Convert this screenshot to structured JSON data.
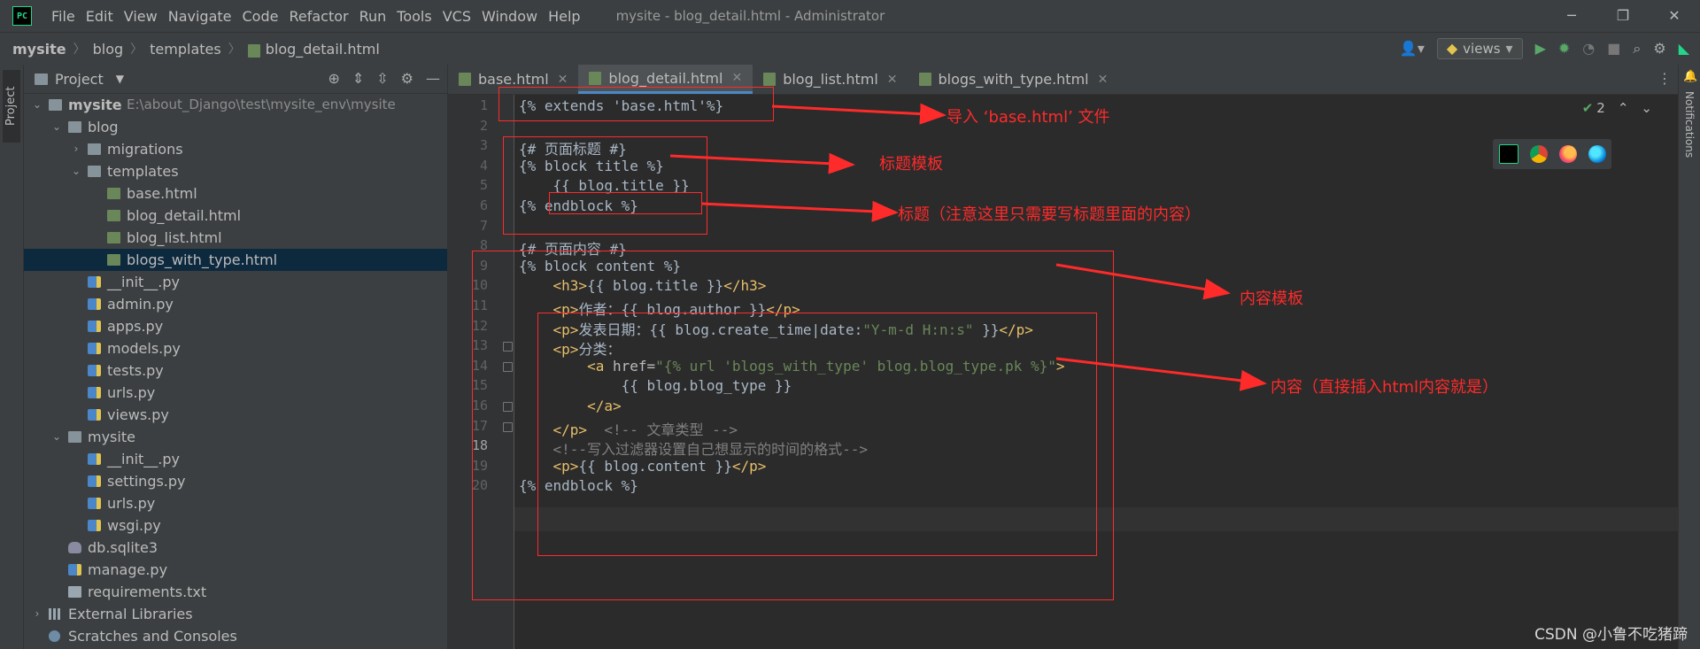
{
  "window": {
    "title": "mysite - blog_detail.html - Administrator",
    "menu": [
      "File",
      "Edit",
      "View",
      "Navigate",
      "Code",
      "Refactor",
      "Run",
      "Tools",
      "VCS",
      "Window",
      "Help"
    ],
    "controls": {
      "minimize": "─",
      "maximize": "❐",
      "close": "✕"
    }
  },
  "breadcrumb": [
    "mysite",
    "blog",
    "templates",
    "blog_detail.html"
  ],
  "toolbar": {
    "run_config": "views"
  },
  "project_panel": {
    "tab_label": "Project",
    "title": "Project",
    "tree": [
      {
        "label": "mysite",
        "path": "E:\\about_Django\\test\\mysite_env\\mysite",
        "depth": 0,
        "icon": "folder",
        "arrow": "open"
      },
      {
        "label": "blog",
        "depth": 1,
        "icon": "folder",
        "arrow": "open"
      },
      {
        "label": "migrations",
        "depth": 2,
        "icon": "folder",
        "arrow": "closed"
      },
      {
        "label": "templates",
        "depth": 2,
        "icon": "folder",
        "arrow": "open"
      },
      {
        "label": "base.html",
        "depth": 3,
        "icon": "html"
      },
      {
        "label": "blog_detail.html",
        "depth": 3,
        "icon": "html"
      },
      {
        "label": "blog_list.html",
        "depth": 3,
        "icon": "html"
      },
      {
        "label": "blogs_with_type.html",
        "depth": 3,
        "icon": "html",
        "selected": true
      },
      {
        "label": "__init__.py",
        "depth": 2,
        "icon": "py"
      },
      {
        "label": "admin.py",
        "depth": 2,
        "icon": "py"
      },
      {
        "label": "apps.py",
        "depth": 2,
        "icon": "py"
      },
      {
        "label": "models.py",
        "depth": 2,
        "icon": "py"
      },
      {
        "label": "tests.py",
        "depth": 2,
        "icon": "py"
      },
      {
        "label": "urls.py",
        "depth": 2,
        "icon": "py"
      },
      {
        "label": "views.py",
        "depth": 2,
        "icon": "py"
      },
      {
        "label": "mysite",
        "depth": 1,
        "icon": "folder",
        "arrow": "open"
      },
      {
        "label": "__init__.py",
        "depth": 2,
        "icon": "py"
      },
      {
        "label": "settings.py",
        "depth": 2,
        "icon": "py"
      },
      {
        "label": "urls.py",
        "depth": 2,
        "icon": "py"
      },
      {
        "label": "wsgi.py",
        "depth": 2,
        "icon": "py"
      },
      {
        "label": "db.sqlite3",
        "depth": 1,
        "icon": "db"
      },
      {
        "label": "manage.py",
        "depth": 1,
        "icon": "py"
      },
      {
        "label": "requirements.txt",
        "depth": 1,
        "icon": "txt"
      },
      {
        "label": "External Libraries",
        "depth": 0,
        "icon": "lib",
        "arrow": "closed"
      },
      {
        "label": "Scratches and Consoles",
        "depth": 0,
        "icon": "scratch"
      }
    ]
  },
  "tabs": [
    {
      "label": "base.html",
      "active": false
    },
    {
      "label": "blog_detail.html",
      "active": true
    },
    {
      "label": "blog_list.html",
      "active": false
    },
    {
      "label": "blogs_with_type.html",
      "active": false
    }
  ],
  "editor": {
    "inspection_count": "2",
    "current_line": 18,
    "line_numbers": [
      "1",
      "2",
      "3",
      "4",
      "5",
      "6",
      "7",
      "8",
      "9",
      "10",
      "11",
      "12",
      "13",
      "14",
      "15",
      "16",
      "17",
      "18",
      "19",
      "20"
    ],
    "lines": [
      [
        [
          "tpl",
          "{% extends 'base.html'%}"
        ]
      ],
      [],
      [
        [
          "tpl",
          "{# 页面标题 #}"
        ]
      ],
      [
        [
          "tpl",
          "{% block title %}"
        ]
      ],
      [
        [
          "tpl",
          "    {{ blog.title }}"
        ]
      ],
      [
        [
          "tpl",
          "{% endblock %}"
        ]
      ],
      [],
      [
        [
          "tpl",
          "{# 页面内容 #}"
        ]
      ],
      [
        [
          "tpl",
          "{% block content %}"
        ]
      ],
      [
        [
          "tpl",
          "    "
        ],
        [
          "tag",
          "<h3>"
        ],
        [
          "tpl",
          "{{ blog.title }}"
        ],
        [
          "tag",
          "</h3>"
        ]
      ],
      [
        [
          "tpl",
          "    "
        ],
        [
          "tag",
          "<p>"
        ],
        [
          "tpl",
          "作者：{{ blog.author }}"
        ],
        [
          "tag",
          "</p>"
        ]
      ],
      [
        [
          "tpl",
          "    "
        ],
        [
          "tag",
          "<p>"
        ],
        [
          "tpl",
          "发表日期：{{ blog.create_time|date:"
        ],
        [
          "str",
          "\"Y-m-d H:n:s\""
        ],
        [
          "tpl",
          " }}"
        ],
        [
          "tag",
          "</p>"
        ]
      ],
      [
        [
          "tpl",
          "    "
        ],
        [
          "tag",
          "<p>"
        ],
        [
          "tpl",
          "分类："
        ]
      ],
      [
        [
          "tpl",
          "        "
        ],
        [
          "tag",
          "<a "
        ],
        [
          "attr",
          "href="
        ],
        [
          "str",
          "\"{% url 'blogs_with_type' blog.blog_type.pk %}\""
        ],
        [
          "tag",
          ">"
        ]
      ],
      [
        [
          "tpl",
          "            {{ blog.blog_type }}"
        ]
      ],
      [
        [
          "tpl",
          "        "
        ],
        [
          "tag",
          "</a>"
        ]
      ],
      [
        [
          "tpl",
          "    "
        ],
        [
          "tag",
          "</p>"
        ],
        [
          "cmt",
          "  <!-- 文章类型 -->"
        ]
      ],
      [
        [
          "cmt",
          "    <!--写入过滤器设置自己想显示的时间的格式-->"
        ]
      ],
      [
        [
          "tpl",
          "    "
        ],
        [
          "tag",
          "<p>"
        ],
        [
          "tpl",
          "{{ blog.content }}"
        ],
        [
          "tag",
          "</p>"
        ]
      ],
      [
        [
          "tpl",
          "{% endblock %}"
        ]
      ]
    ]
  },
  "annotations": {
    "import_base": "导入 ‘base.html’ 文件",
    "title_template": "标题模板",
    "title_note": "标题（注意这里只需要写标题里面的内容）",
    "content_template": "内容模板",
    "content_note": "内容（直接插入html内容就是）"
  },
  "side_tabs": {
    "right": "Notifications"
  },
  "watermark": "CSDN @小鲁不吃猪蹄",
  "colors": {
    "annotation": "#ff2a2a",
    "tag": "#e8bf6a",
    "string": "#6a8759",
    "comment": "#808080",
    "selection": "#0d293e"
  }
}
